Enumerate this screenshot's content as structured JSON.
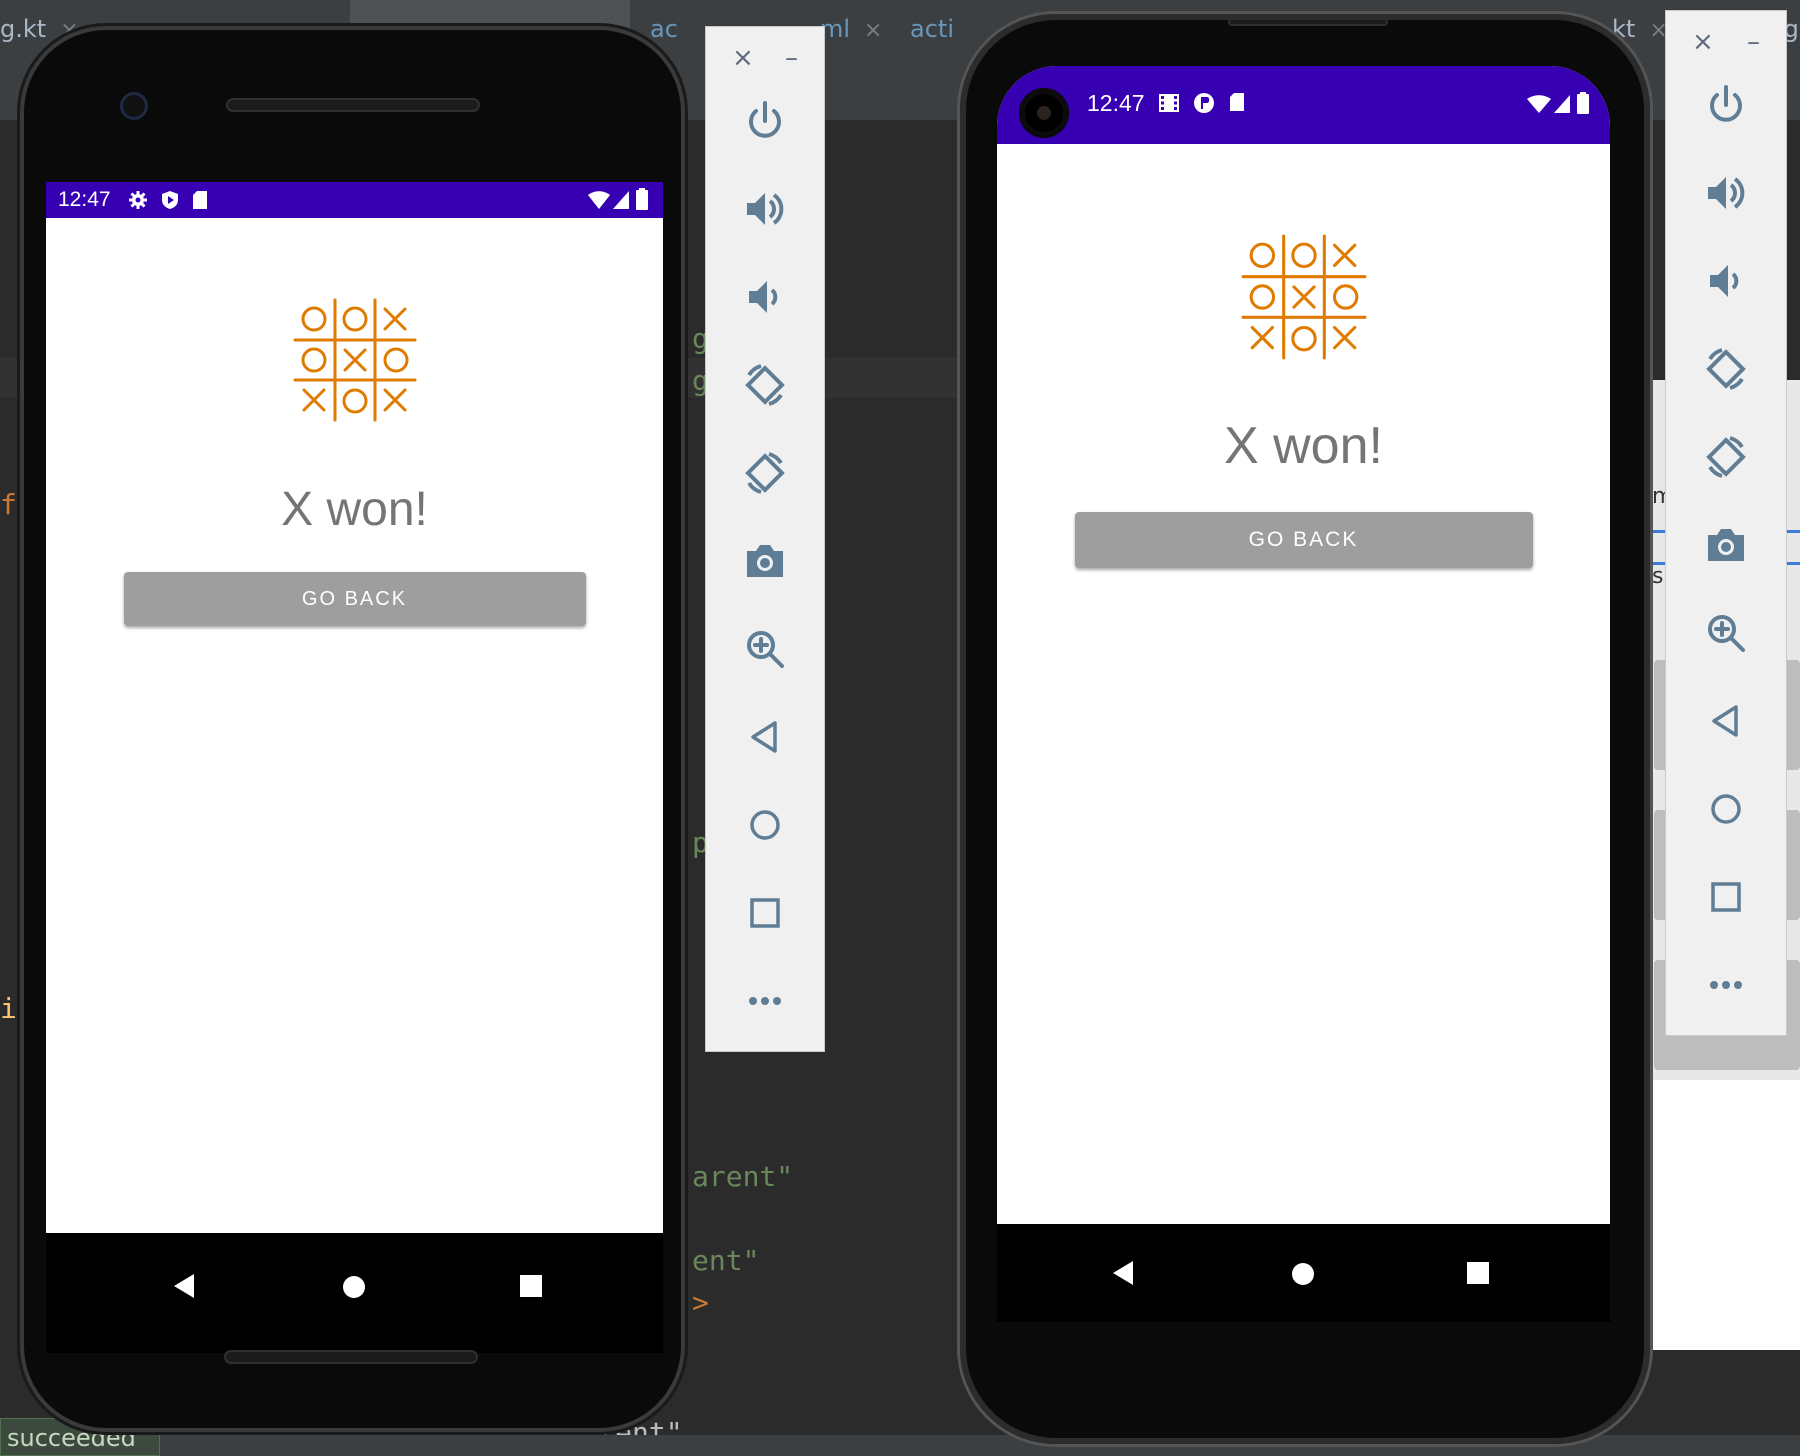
{
  "ide": {
    "tabs": [
      {
        "label": "g.kt",
        "close": "×"
      },
      {
        "label": "",
        "close": ""
      },
      {
        "label": "ac",
        "close": ""
      },
      {
        "label": "ml",
        "close": "×"
      },
      {
        "label": "acti",
        "close": ""
      },
      {
        "label": "kt",
        "close": "×"
      },
      {
        "label": ".g",
        "close": ""
      }
    ],
    "code_fragments": [
      "fe",
      "i",
      "g",
      "g",
      "p",
      "arent\"",
      "ent\"",
      ">",
      "oid:layout_width=\"wrap_content\""
    ],
    "side_text": [
      "me",
      "s"
    ],
    "status": "succeeded"
  },
  "phones": [
    {
      "status_time": "12:47",
      "result_text": "X won!",
      "button_label": "GO BACK"
    },
    {
      "status_time": "12:47",
      "result_text": "X won!",
      "button_label": "GO BACK"
    }
  ],
  "logo": {
    "grid": [
      [
        "O",
        "O",
        "X"
      ],
      [
        "O",
        "X",
        "O"
      ],
      [
        "X",
        "O",
        "X"
      ]
    ],
    "color": "#e07b00"
  },
  "colors": {
    "status_bar": "#3700b3",
    "button": "#9e9e9e",
    "result_text": "#757575",
    "ide_bg": "#2b2b2b"
  },
  "emulator_toolbar": {
    "close": "×",
    "minimize": "–",
    "buttons": [
      "power-icon",
      "volume-up-icon",
      "volume-down-icon",
      "rotate-left-icon",
      "rotate-right-icon",
      "camera-icon",
      "zoom-icon",
      "back-icon",
      "home-icon",
      "overview-icon",
      "more-icon"
    ]
  }
}
